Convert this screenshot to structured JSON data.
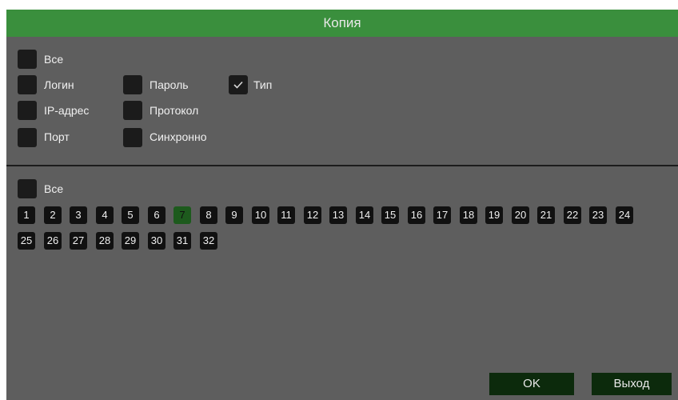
{
  "dialog": {
    "title": "Копия"
  },
  "options": {
    "all": {
      "label": "Все",
      "checked": false
    },
    "login": {
      "label": "Логин",
      "checked": false
    },
    "password": {
      "label": "Пароль",
      "checked": false
    },
    "type": {
      "label": "Тип",
      "checked": true
    },
    "ip": {
      "label": "IP-адрес",
      "checked": false
    },
    "protocol": {
      "label": "Протокол",
      "checked": false
    },
    "port": {
      "label": "Порт",
      "checked": false
    },
    "sync": {
      "label": "Синхронно",
      "checked": false
    }
  },
  "channels": {
    "all": {
      "label": "Все",
      "checked": false
    },
    "items": [
      "1",
      "2",
      "3",
      "4",
      "5",
      "6",
      "7",
      "8",
      "9",
      "10",
      "11",
      "12",
      "13",
      "14",
      "15",
      "16",
      "17",
      "18",
      "19",
      "20",
      "21",
      "22",
      "23",
      "24",
      "25",
      "26",
      "27",
      "28",
      "29",
      "30",
      "31",
      "32"
    ],
    "selected": "7"
  },
  "buttons": {
    "ok": "OK",
    "exit": "Выход"
  },
  "colors": {
    "title_bar": "#3a8f3d",
    "panel": "#5e5e5e",
    "selected_channel": "#1d5a1d",
    "button": "#0c2a0c"
  },
  "icons": {
    "check": "check-icon"
  }
}
